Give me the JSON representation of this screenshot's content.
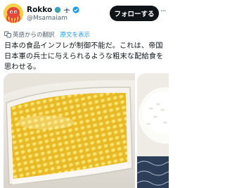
{
  "post": {
    "author_name": "Rokko",
    "author_handle": "@Msamaiam",
    "follow_label": "フォローする",
    "more_label": "···",
    "translated_from": "英語からの翻訳",
    "show_original": "原文を表示",
    "text": "日本の食品インフレが制御不能だ。これは、帝国日本軍の兵士に与えられるような粗末な配給食を思わせる。"
  },
  "icons": {
    "avatar": "octopus-avatar",
    "badges": [
      "globe-icon",
      "airplane-icon",
      "verified-badge-icon"
    ],
    "translate": "translate-icon",
    "more": "more-icon"
  },
  "colors": {
    "link": "#1d9bf0",
    "verified": "#1d9bf0",
    "follow_bg": "#0f1419",
    "secondary_text": "#536471"
  }
}
